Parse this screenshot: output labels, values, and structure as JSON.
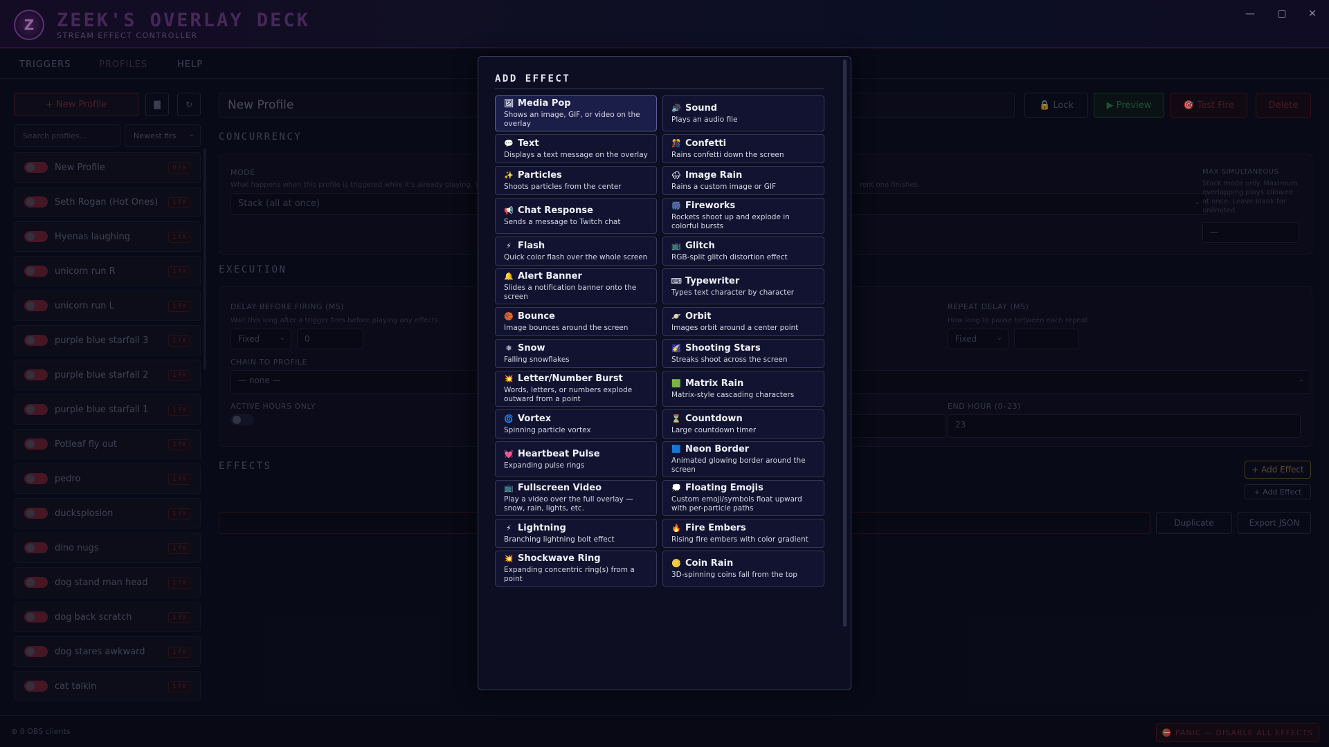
{
  "app": {
    "logo_letter": "Z",
    "title": "ZEEK'S OVERLAY DECK",
    "subtitle": "STREAM EFFECT CONTROLLER",
    "window_controls": {
      "minimize": "—",
      "maximize": "▢",
      "close": "✕"
    }
  },
  "nav": {
    "triggers": "TRIGGERS",
    "profiles": "PROFILES",
    "help": "HELP"
  },
  "sidebar": {
    "new_profile_label": "+ New Profile",
    "search_placeholder": "Search profiles...",
    "sort_value": "Newest firs",
    "profiles": [
      {
        "name": "New Profile",
        "fx": "0 FX"
      },
      {
        "name": "Seth Rogan (Hot Ones)",
        "fx": "1 FX"
      },
      {
        "name": "Hyenas laughing",
        "fx": "1 FX"
      },
      {
        "name": "unicorn run R",
        "fx": "1 FX"
      },
      {
        "name": "unicorn run L",
        "fx": "1 FX"
      },
      {
        "name": "purple blue starfall 3",
        "fx": "1 FX"
      },
      {
        "name": "purple blue starfall 2",
        "fx": "1 FX"
      },
      {
        "name": "purple blue starfall 1",
        "fx": "1 FX"
      },
      {
        "name": "Potleaf fly out",
        "fx": "1 FX"
      },
      {
        "name": "pedro",
        "fx": "1 FX"
      },
      {
        "name": "ducksplosion",
        "fx": "1 FX"
      },
      {
        "name": "dino nugs",
        "fx": "1 FX"
      },
      {
        "name": "dog stand man head",
        "fx": "1 FX"
      },
      {
        "name": "dog back scratch",
        "fx": "1 FX"
      },
      {
        "name": "dog stares awkward",
        "fx": "1 FX"
      },
      {
        "name": "cat talkin",
        "fx": "1 FX"
      }
    ]
  },
  "main": {
    "profile_name": "New Profile",
    "lock_label": "🔒 Lock",
    "preview_label": "▶ Preview",
    "testfire_label": "🎯 Test Fire",
    "delete_label": "Delete",
    "concurrency_title": "CONCURRENCY",
    "mode_label": "MODE",
    "mode_hint": "What happens when this profile is triggered while it's already playing. St",
    "mode_hint_tail": "rent one finishes.",
    "mode_value": "Stack (all at once)",
    "max_sim_label": "MAX SIMULTANEOUS",
    "max_sim_hint": "Stack mode only. Maximum overlapping plays allowed at once. Leave blank for unlimited.",
    "max_sim_placeholder": "—",
    "execution_title": "EXECUTION",
    "delay_label": "DELAY BEFORE FIRING (MS)",
    "delay_hint": "Wait this long after a trigger fires before playing any effects.",
    "delay_mode": "Fixed",
    "delay_value": "0",
    "repeat_delay_label": "REPEAT DELAY (MS)",
    "repeat_delay_hint": "How long to pause between each repeat.",
    "repeat_mode": "Fixed",
    "chain_label": "CHAIN TO PROFILE",
    "chain_value": "— none —",
    "active_hours_label": "ACTIVE HOURS ONLY",
    "end_hour_label": "END HOUR (0–23)",
    "end_hour_value": "23",
    "effects_title": "EFFECTS",
    "add_effect_label": "+ Add Effect",
    "add_effect_label2": "+ Add Effect",
    "duplicate_label": "Duplicate",
    "export_label": "Export JSON"
  },
  "status": {
    "obs_clients": "⊚ 0 OBS clients",
    "panic_label": "⛔ PANIC — DISABLE ALL EFFECTS"
  },
  "modal": {
    "title": "ADD EFFECT",
    "rows": [
      [
        {
          "icon": "🖼",
          "title": "Media Pop",
          "desc": "Shows an image, GIF, or video on the overlay",
          "icon_name": "image-icon"
        },
        {
          "icon": "🔊",
          "title": "Sound",
          "desc": "Plays an audio file",
          "icon_name": "speaker-icon"
        }
      ],
      [
        {
          "icon": "💬",
          "title": "Text",
          "desc": "Displays a text message on the overlay",
          "icon_name": "speech-bubble-icon"
        },
        {
          "icon": "🎊",
          "title": "Confetti",
          "desc": "Rains confetti down the screen",
          "icon_name": "confetti-icon"
        }
      ],
      [
        {
          "icon": "✨",
          "title": "Particles",
          "desc": "Shoots particles from the center",
          "icon_name": "sparkles-icon"
        },
        {
          "icon": "🌧",
          "title": "Image Rain",
          "desc": "Rains a custom image or GIF",
          "icon_name": "rain-cloud-icon"
        }
      ],
      [
        {
          "icon": "📢",
          "title": "Chat Response",
          "desc": "Sends a message to Twitch chat",
          "icon_name": "megaphone-icon"
        },
        {
          "icon": "🎆",
          "title": "Fireworks",
          "desc": "Rockets shoot up and explode in colorful bursts",
          "icon_name": "fireworks-icon"
        }
      ],
      [
        {
          "icon": "⚡",
          "title": "Flash",
          "desc": "Quick color flash over the whole screen",
          "icon_name": "lightning-icon"
        },
        {
          "icon": "📺",
          "title": "Glitch",
          "desc": "RGB-split glitch distortion effect",
          "icon_name": "tv-icon"
        }
      ],
      [
        {
          "icon": "🔔",
          "title": "Alert Banner",
          "desc": "Slides a notification banner onto the screen",
          "icon_name": "bell-icon"
        },
        {
          "icon": "⌨",
          "title": "Typewriter",
          "desc": "Types text character by character",
          "icon_name": "keyboard-icon"
        }
      ],
      [
        {
          "icon": "🏀",
          "title": "Bounce",
          "desc": "Image bounces around the screen",
          "icon_name": "ball-icon"
        },
        {
          "icon": "🪐",
          "title": "Orbit",
          "desc": "Images orbit around a center point",
          "icon_name": "planet-icon"
        }
      ],
      [
        {
          "icon": "❄",
          "title": "Snow",
          "desc": "Falling snowflakes",
          "icon_name": "snowflake-icon"
        },
        {
          "icon": "🌠",
          "title": "Shooting Stars",
          "desc": "Streaks shoot across the screen",
          "icon_name": "shooting-star-icon"
        }
      ],
      [
        {
          "icon": "💥",
          "title": "Letter/Number Burst",
          "desc": "Words, letters, or numbers explode outward from a point",
          "icon_name": "burst-icon"
        },
        {
          "icon": "🟩",
          "title": "Matrix Rain",
          "desc": "Matrix-style cascading characters",
          "icon_name": "green-square-icon"
        }
      ],
      [
        {
          "icon": "🌀",
          "title": "Vortex",
          "desc": "Spinning particle vortex",
          "icon_name": "vortex-icon"
        },
        {
          "icon": "⏳",
          "title": "Countdown",
          "desc": "Large countdown timer",
          "icon_name": "hourglass-icon"
        }
      ],
      [
        {
          "icon": "💓",
          "title": "Heartbeat Pulse",
          "desc": "Expanding pulse rings",
          "icon_name": "heart-icon"
        },
        {
          "icon": "🟦",
          "title": "Neon Border",
          "desc": "Animated glowing border around the screen",
          "icon_name": "blue-square-icon"
        }
      ],
      [
        {
          "icon": "📺",
          "title": "Fullscreen Video",
          "desc": "Play a video over the full overlay — snow, rain, lights, etc.",
          "icon_name": "video-icon"
        },
        {
          "icon": "💭",
          "title": "Floating Emojis",
          "desc": "Custom emoji/symbols float upward with per-particle paths",
          "icon_name": "thought-bubble-icon"
        }
      ],
      [
        {
          "icon": "⚡",
          "title": "Lightning",
          "desc": "Branching lightning bolt effect",
          "icon_name": "lightning-bolt-icon"
        },
        {
          "icon": "🔥",
          "title": "Fire Embers",
          "desc": "Rising fire embers with color gradient",
          "icon_name": "fire-icon"
        }
      ],
      [
        {
          "icon": "💥",
          "title": "Shockwave Ring",
          "desc": "Expanding concentric ring(s) from a point",
          "icon_name": "shockwave-icon"
        },
        {
          "icon": "🪙",
          "title": "Coin Rain",
          "desc": "3D-spinning coins fall from the top",
          "icon_name": "coin-icon"
        }
      ]
    ]
  }
}
